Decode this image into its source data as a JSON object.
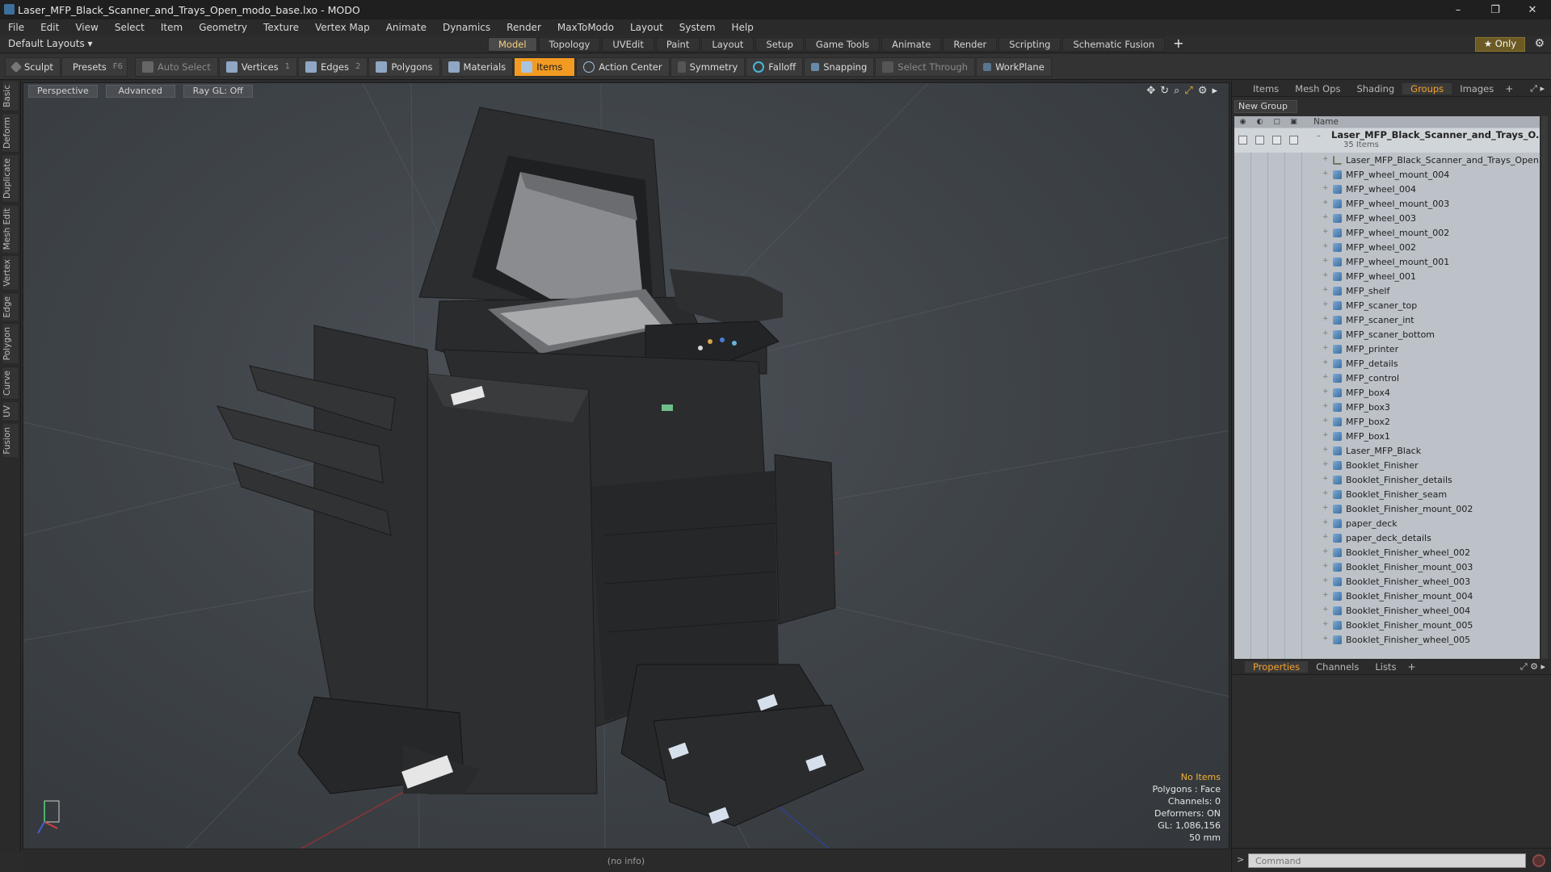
{
  "window": {
    "title": "Laser_MFP_Black_Scanner_and_Trays_Open_modo_base.lxo - MODO",
    "controls": [
      "–",
      "❐",
      "✕"
    ]
  },
  "menubar": [
    "File",
    "Edit",
    "View",
    "Select",
    "Item",
    "Geometry",
    "Texture",
    "Vertex Map",
    "Animate",
    "Dynamics",
    "Render",
    "MaxToModo",
    "Layout",
    "System",
    "Help"
  ],
  "layoutbar": {
    "layout_dropdown": "Default Layouts ▾",
    "tabs": [
      "Model",
      "Topology",
      "UVEdit",
      "Paint",
      "Layout",
      "Setup",
      "Game Tools",
      "Animate",
      "Render",
      "Scripting",
      "Schematic Fusion"
    ],
    "active_tab": "Model",
    "only_label": "★  Only"
  },
  "toolbar": {
    "sculpt": "Sculpt",
    "presets": "Presets",
    "presets_key": "F6",
    "auto_select": "Auto Select",
    "vertices": "Vertices",
    "vertices_key": "1",
    "edges": "Edges",
    "edges_key": "2",
    "polygons": "Polygons",
    "materials": "Materials",
    "items": "Items",
    "action_center": "Action Center",
    "symmetry": "Symmetry",
    "falloff": "Falloff",
    "snapping": "Snapping",
    "select_through": "Select Through",
    "workplane": "WorkPlane"
  },
  "left_strip": [
    "Basic",
    "Deform",
    "Duplicate",
    "Mesh Edit",
    "Vertex",
    "Edge",
    "Polygon",
    "Curve",
    "UV",
    "Fusion"
  ],
  "viewport": {
    "view_mode": "Perspective",
    "shading": "Advanced",
    "raygl": "Ray GL: Off",
    "info": {
      "no_items": "No Items",
      "polygons": "Polygons : Face",
      "channels": "Channels: 0",
      "deformers": "Deformers: ON",
      "gl": "GL: 1,086,156",
      "size": "50 mm"
    }
  },
  "status": "(no info)",
  "right_panel": {
    "top_tabs": [
      "Items",
      "Mesh Ops",
      "Shading",
      "Groups",
      "Images"
    ],
    "active_top_tab": "Groups",
    "new_group": "New Group",
    "name_header": "Name",
    "root_group": "Laser_MFP_Black_Scanner_and_Trays_O...",
    "root_count": "35 Items",
    "items": [
      "Laser_MFP_Black_Scanner_and_Trays_Open",
      "MFP_wheel_mount_004",
      "MFP_wheel_004",
      "MFP_wheel_mount_003",
      "MFP_wheel_003",
      "MFP_wheel_mount_002",
      "MFP_wheel_002",
      "MFP_wheel_mount_001",
      "MFP_wheel_001",
      "MFP_shelf",
      "MFP_scaner_top",
      "MFP_scaner_int",
      "MFP_scaner_bottom",
      "MFP_printer",
      "MFP_details",
      "MFP_control",
      "MFP_box4",
      "MFP_box3",
      "MFP_box2",
      "MFP_box1",
      "Laser_MFP_Black",
      "Booklet_Finisher",
      "Booklet_Finisher_details",
      "Booklet_Finisher_seam",
      "Booklet_Finisher_mount_002",
      "paper_deck",
      "paper_deck_details",
      "Booklet_Finisher_wheel_002",
      "Booklet_Finisher_mount_003",
      "Booklet_Finisher_wheel_003",
      "Booklet_Finisher_mount_004",
      "Booklet_Finisher_wheel_004",
      "Booklet_Finisher_mount_005",
      "Booklet_Finisher_wheel_005"
    ],
    "bottom_tabs": [
      "Properties",
      "Channels",
      "Lists"
    ],
    "active_bottom_tab": "Properties",
    "command_placeholder": "Command"
  },
  "colors": {
    "accent": "#f29b23",
    "viewport_bg": "#3f4449",
    "list_bg": "#bcc2c8"
  }
}
